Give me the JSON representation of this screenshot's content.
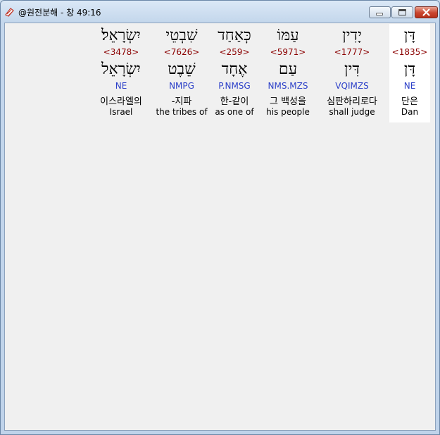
{
  "window": {
    "title": "@원전분해 - 창 49:16",
    "colors": {
      "strong": "#8b0000",
      "morph": "#2b3fc8",
      "selected_bg": "#ffffff"
    }
  },
  "words": [
    {
      "hebrew": "יִשְׂרָאֵל׃",
      "strong": "<3478>",
      "lexeme": "יִשְׂרָאֵל",
      "morph": "NE",
      "korean": "이스라엘의",
      "english": "Israel"
    },
    {
      "hebrew": "שִׁבְטֵי",
      "strong": "<7626>",
      "lexeme": "שֵׁבֶט",
      "morph": "NMPG",
      "korean": "-지파",
      "english": "the tribes of"
    },
    {
      "hebrew": "כְּאַחַד",
      "strong": "<259>",
      "lexeme": "אֶחָד",
      "morph": "P.NMSG",
      "korean": "한-같이",
      "english": "as one of"
    },
    {
      "hebrew": "עַמּוֹ",
      "strong": "<5971>",
      "lexeme": "עַם",
      "morph": "NMS.MZS",
      "korean": "그 백성을",
      "english": "his people"
    },
    {
      "hebrew": "יָדִין",
      "strong": "<1777>",
      "lexeme": "דִּין",
      "morph": "VQIMZS",
      "korean": "심판하리로다",
      "english": "shall judge"
    },
    {
      "hebrew": "דָּן",
      "strong": "<1835>",
      "lexeme": "דָּן",
      "morph": "NE",
      "korean": "단은",
      "english": "Dan",
      "selected": true
    }
  ]
}
